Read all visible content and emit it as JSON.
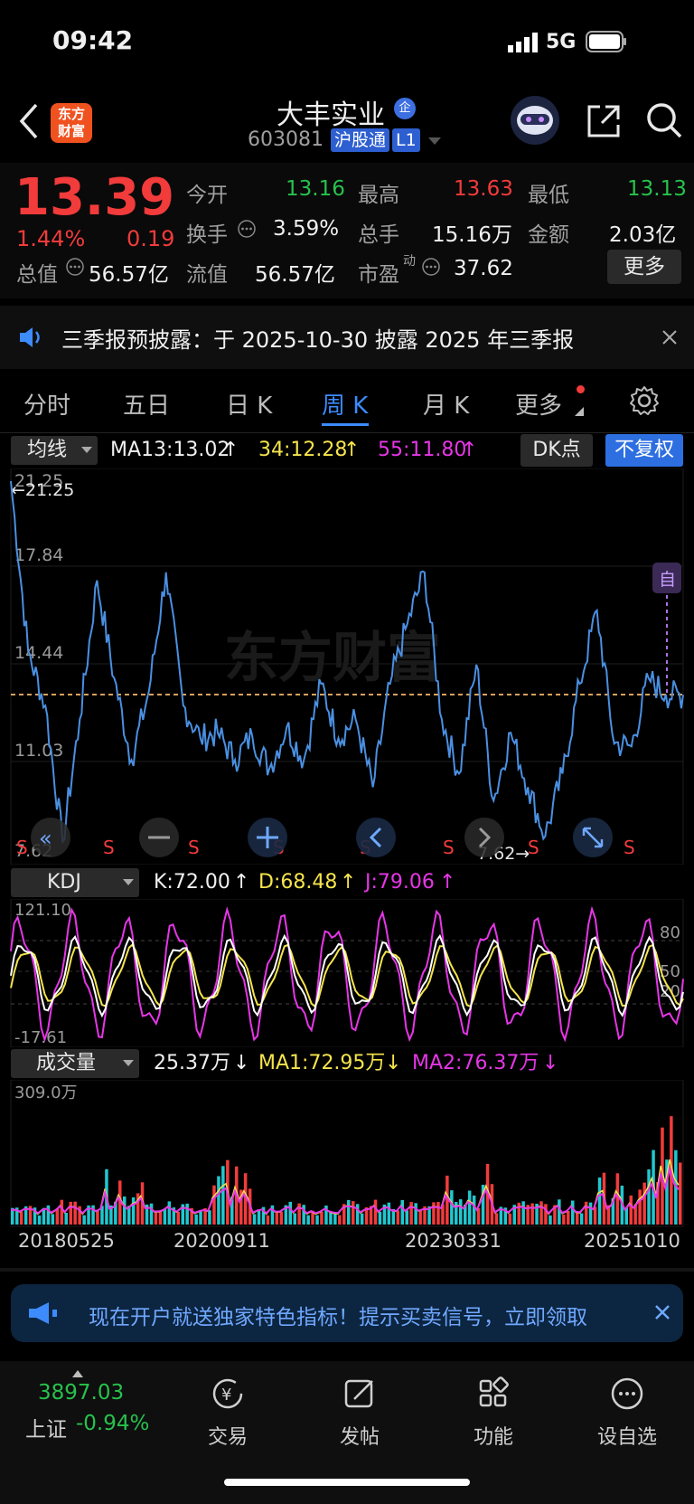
{
  "status": {
    "time": "09:42",
    "network": "5G"
  },
  "header": {
    "logo_line1": "东方",
    "logo_line2": "财富",
    "stock_name": "大丰实业",
    "name_badge": "企",
    "code": "603081",
    "exchange_tag": "沪股通",
    "level_tag": "L1"
  },
  "quote": {
    "price": "13.39",
    "change_pct": "1.44%",
    "change_amt": "0.19",
    "open_label": "今开",
    "open": "13.16",
    "high_label": "最高",
    "high": "13.63",
    "low_label": "最低",
    "low": "13.13",
    "turnover_label": "换手",
    "turnover": "3.59%",
    "volume_label": "总手",
    "volume": "15.16万",
    "amount_label": "金额",
    "amount": "2.03亿",
    "mktcap_label": "总值",
    "mktcap": "56.57亿",
    "float_label": "流值",
    "float": "56.57亿",
    "pe_label": "市盈",
    "pe_sup": "动",
    "pe": "37.62",
    "more_label": "更多"
  },
  "notice": {
    "text": "三季报预披露：于 2025-10-30 披露 2025 年三季报"
  },
  "tabs": {
    "t1": "分时",
    "t2": "五日",
    "t3": "日 K",
    "t4": "周 K",
    "t5": "月 K",
    "t6": "更多"
  },
  "main_chart": {
    "dropdown": "均线",
    "ma13": "MA13:13.02",
    "ma34": "34:12.28",
    "ma55": "55:11.80",
    "dk_label": "DK点",
    "adjust_label": "不复权",
    "y_labels": [
      "21.25",
      "17.84",
      "14.44",
      "11.03",
      "7.62"
    ],
    "max_marker": "←21.25",
    "min_marker": "7.62→",
    "self_tag": "自",
    "s_mark": "S",
    "watermark": "东方财富"
  },
  "kdj": {
    "dropdown": "KDJ",
    "k": "K:72.00",
    "d": "D:68.48",
    "j": "J:79.06",
    "y_top": "121.10",
    "y_bottom": "-17.61",
    "lvl80": "80",
    "lvl50": "50",
    "lvl20": "20"
  },
  "volume": {
    "dropdown": "成交量",
    "vol": "25.37万",
    "ma1": "MA1:72.95万",
    "ma2": "MA2:76.37万",
    "y_top": "309.0万"
  },
  "dates": [
    "20180525",
    "20200911",
    "20230331",
    "20251010"
  ],
  "ad": {
    "text": "现在开户就送独家特色指标！提示买卖信号，立即领取"
  },
  "bottom_nav": {
    "index_value": "3897.03",
    "index_name": "上证",
    "index_change": "-0.94%",
    "trade": "交易",
    "post": "发帖",
    "func": "功能",
    "watch": "设自选"
  },
  "colors": {
    "up": "#f23b3b",
    "down": "#27c24c",
    "accent": "#3d8bfd",
    "ma_line": "#4a90e2"
  },
  "chart_data": {
    "type": "line",
    "x": [
      "20180525",
      "20200911",
      "20230331",
      "20251010"
    ],
    "series": [
      {
        "values": [
          21.25,
          15.0,
          13.0,
          8.0,
          12.5,
          17.6,
          14.0,
          11.0,
          13.5,
          17.9,
          13.0,
          11.8,
          12.0,
          11.0,
          11.9,
          10.7,
          12.2,
          11.0,
          13.8,
          11.8,
          12.5,
          10.0,
          13.8,
          16.0,
          17.9,
          12.5,
          10.5,
          14.5,
          9.5,
          12.0,
          10.0,
          8.2,
          10.5,
          13.8,
          16.5,
          11.6,
          11.5,
          14.0,
          13.4,
          13.39
        ]
      }
    ],
    "ylim": [
      7.62,
      21.25
    ]
  }
}
